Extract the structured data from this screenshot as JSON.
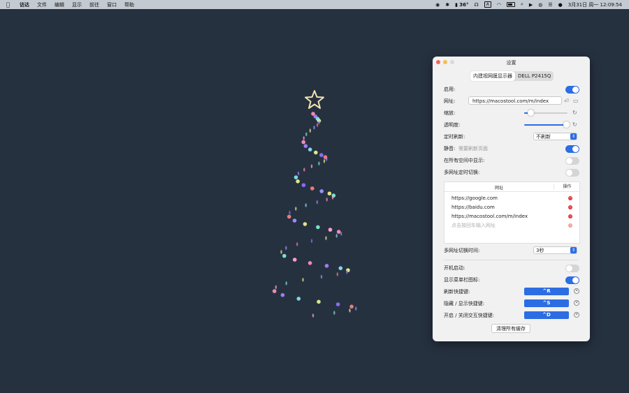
{
  "menubar": {
    "app": "访达",
    "items": [
      "文件",
      "编辑",
      "显示",
      "前往",
      "窗口",
      "帮助"
    ],
    "temperature": "36°",
    "input_source": "A",
    "datetime": "3月31日 周一  12:09:54"
  },
  "window": {
    "title": "设置",
    "tabs": [
      "内建视网膜显示器",
      "DELL P2415Q"
    ],
    "enable_label": "启用:",
    "url_label": "网址:",
    "url_value": "https://macostool.com/m/index",
    "zoom_label": "缩放:",
    "zoom_level": 0.14,
    "opacity_label": "透明度:",
    "opacity_level": 0.96,
    "refresh_label": "定时刷新:",
    "refresh_value": "不刷新",
    "mute_label": "静音:",
    "mute_hint": "需要刷新页面",
    "all_spaces_label": "在所有空间中显示:",
    "multi_url_label": "多网址定时切换:",
    "table": {
      "col_url": "网址",
      "col_action": "操作",
      "rows": [
        "https://google.com",
        "https://baidu.com",
        "https://macostool.com/m/index"
      ],
      "placeholder": "点击按回车输入网址"
    },
    "switch_time_label": "多网址切换时间:",
    "switch_time_value": "3秒",
    "launch_label": "开机启动:",
    "menubar_icon_label": "显示菜单栏图标:",
    "refresh_hotkey_label": "刷新快捷键:",
    "refresh_hotkey": "^R",
    "toggle_hotkey_label": "隐藏 / 显示快捷键:",
    "toggle_hotkey": "^S",
    "interact_hotkey_label": "开启 / 关闭交互快捷键:",
    "interact_hotkey": "^D",
    "clear_cache_button": "清理所有缓存"
  },
  "toggles": {
    "enable": true,
    "mute": true,
    "all_spaces": false,
    "multi_url": false,
    "launch": false,
    "menubar_icon": true
  },
  "colors": {
    "accent": "#2c6de3",
    "desktop": "#263140",
    "star": "#f3e4b0"
  }
}
